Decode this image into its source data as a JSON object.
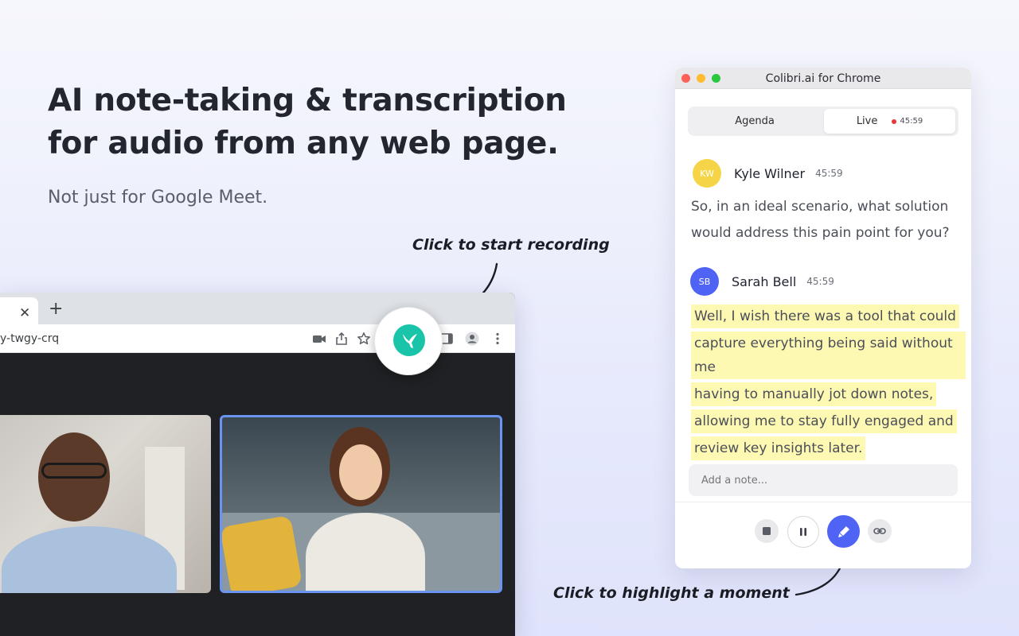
{
  "hero": {
    "headline_line1": "AI note-taking & transcription",
    "headline_line2": "for audio from any web page.",
    "subhead": "Not just for Google Meet."
  },
  "callouts": {
    "record": "Click to start recording",
    "highlight": "Click to highlight a moment"
  },
  "browser": {
    "tab_close": "✕",
    "new_tab": "+",
    "url_fragment": "y-twgy-crq",
    "toolbar_icons": [
      "video-camera-icon",
      "share-icon",
      "star-icon",
      "sidebar-icon",
      "profile-icon",
      "more-vert-icon"
    ],
    "extension_icon": "hummingbird-icon"
  },
  "panel": {
    "window_title": "Colibri.ai for Chrome",
    "tabs": {
      "agenda": "Agenda",
      "live": "Live",
      "live_timer": "45:59"
    },
    "transcript": [
      {
        "initials": "KW",
        "name": "Kyle Wilner",
        "time": "45:59",
        "avatar_color": "#f5d547",
        "lines": [
          "So, in an ideal scenario, what solution",
          "would address this pain point for you?"
        ],
        "highlighted": false
      },
      {
        "initials": "SB",
        "name": "Sarah Bell",
        "time": "45:59",
        "avatar_color": "#4f63f5",
        "lines": [
          "Well, I wish there was a tool that could",
          "capture everything being said without me",
          "having to manually jot down notes,",
          "allowing me to stay fully engaged and",
          "review key insights later."
        ],
        "highlighted": true
      }
    ],
    "note_placeholder": "Add a note...",
    "controls": [
      "stop-icon",
      "pause-icon",
      "highlight-pen-icon",
      "link-icon"
    ]
  },
  "colors": {
    "accent": "#4f63f5",
    "extension_brand": "#19c4a8",
    "highlight": "#fdf9b3",
    "recording": "#e53935"
  }
}
